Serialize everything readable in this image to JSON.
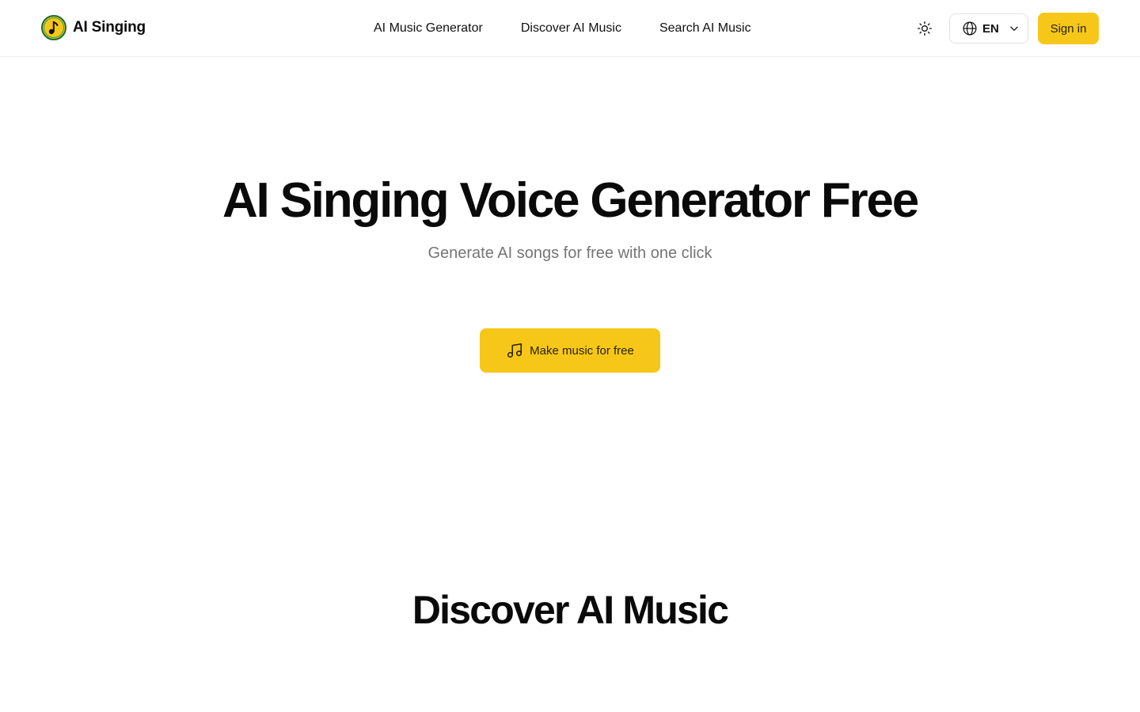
{
  "header": {
    "logo_icon": "music-note-logo-icon",
    "logo_text": "AI Singing",
    "nav": [
      {
        "label": "AI Music Generator"
      },
      {
        "label": "Discover AI Music"
      },
      {
        "label": "Search AI Music"
      }
    ],
    "theme_icon": "sun-icon",
    "language": {
      "icon": "globe-icon",
      "code": "EN",
      "chevron_icon": "chevron-down-icon"
    },
    "sign_in_label": "Sign in"
  },
  "hero": {
    "title": "AI Singing Voice Generator Free",
    "subtitle": "Generate AI songs for free with one click",
    "cta_icon": "music-note-icon",
    "cta_label": "Make music for free"
  },
  "discover": {
    "title": "Discover AI Music"
  },
  "colors": {
    "accent": "#f6c719",
    "logo_ring": "#1a7a3a",
    "subtitle": "#757575"
  }
}
